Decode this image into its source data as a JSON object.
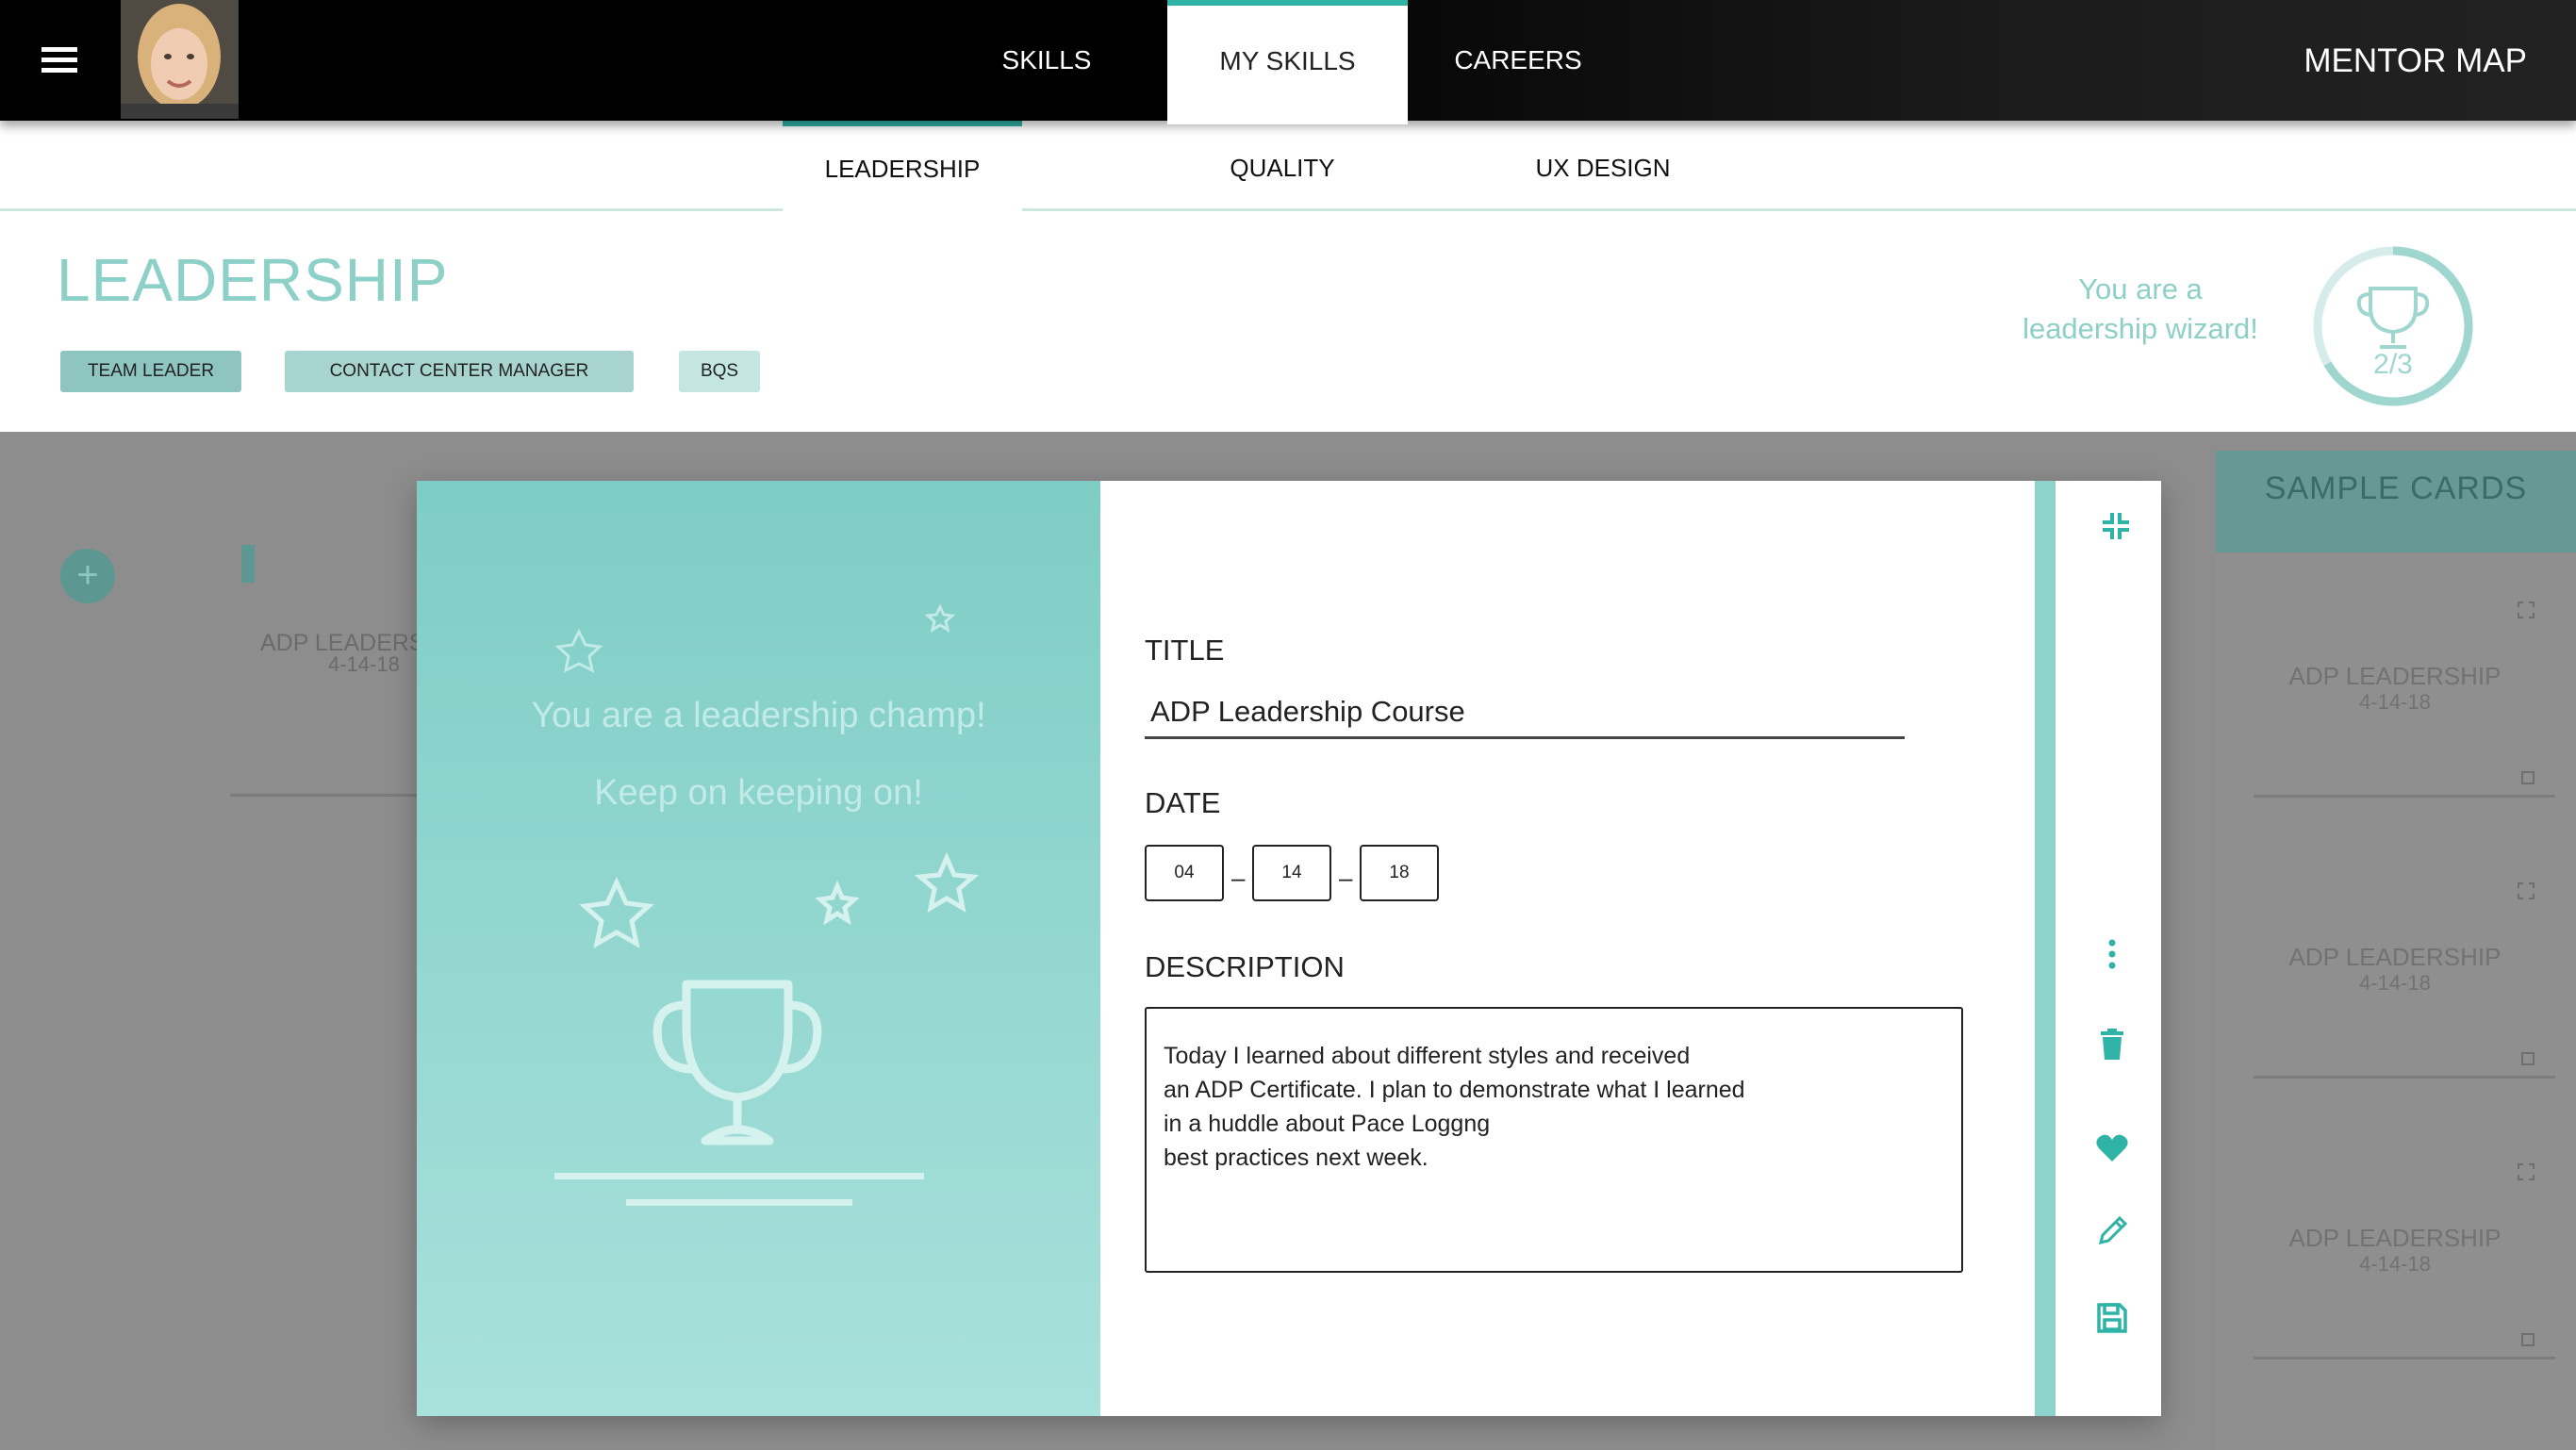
{
  "topbar": {
    "menu_icon": "hamburger-icon",
    "avatar_alt": "user avatar",
    "tabs": [
      {
        "label": "SKILLS"
      },
      {
        "label": "MY SKILLS",
        "active": true
      },
      {
        "label": "CAREERS"
      }
    ],
    "right_label": "MENTOR MAP"
  },
  "subtabs": [
    {
      "label": "LEADERSHIP",
      "active": true
    },
    {
      "label": "QUALITY"
    },
    {
      "label": "UX DESIGN"
    }
  ],
  "header": {
    "title": "LEADERSHIP",
    "chips": [
      "TEAM LEADER",
      "CONTACT CENTER MANAGER",
      "BQS"
    ],
    "wizard_line1": "You are a",
    "wizard_line2": "leadership wizard!",
    "progress_label": "2/3",
    "progress_fraction": 0.667
  },
  "background": {
    "fab_label": "+",
    "card_title": "ADP LEADERSHIP",
    "card_date": "4-14-18",
    "sample_header": "SAMPLE  CARDS",
    "sample_cards": [
      {
        "title": "ADP LEADERSHIP",
        "date": "4-14-18"
      },
      {
        "title": "ADP LEADERSHIP",
        "date": "4-14-18"
      },
      {
        "title": "ADP LEADERSHIP",
        "date": "4-14-18"
      }
    ]
  },
  "modal": {
    "champ_line1": "You are a leadership champ!",
    "champ_line2": "Keep on keeping on!",
    "title_label": "TITLE",
    "title_value": "ADP Leadership Course",
    "date_label": "DATE",
    "date_month": "04",
    "date_day": "14",
    "date_year": "18",
    "date_separator": "–",
    "description_label": "DESCRIPTION",
    "description": "Today I learned about different  styles and received\nan ADP Certificate. I plan to demonstrate what I learned\nin a huddle about Pace Loggng\nbest practices next week.",
    "actions": [
      "collapse-icon",
      "more-vert-icon",
      "delete-icon",
      "favorite-icon",
      "edit-icon",
      "save-icon"
    ]
  },
  "colors": {
    "accent": "#2eb3a6",
    "accent_light": "#8cd0c8",
    "topbar": "#000000",
    "overlay": "#8d8d8d"
  }
}
